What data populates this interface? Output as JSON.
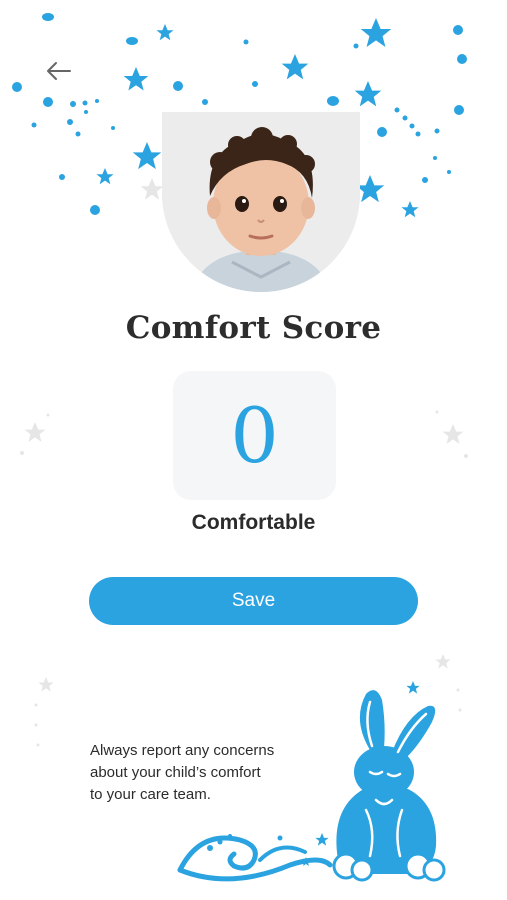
{
  "header": {
    "back_icon": "arrow-left-icon"
  },
  "profile": {
    "photo": "child-photo"
  },
  "score": {
    "title": "Comfort Score",
    "value": "0",
    "label": "Comfortable"
  },
  "actions": {
    "save_label": "Save"
  },
  "footer": {
    "note_line1": "Always report any concerns",
    "note_line2": "about your child’s comfort",
    "note_line3": "to your care team.",
    "illustration": "bunny-illustration"
  },
  "colors": {
    "accent": "#2aa3e0",
    "score_box": "#f5f6f8",
    "text": "#2b2b2b"
  }
}
